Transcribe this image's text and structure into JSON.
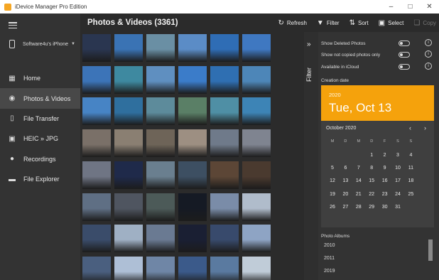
{
  "window": {
    "title": "iDevice Manager Pro Edition",
    "controls": [
      "minimize",
      "maximize",
      "close"
    ]
  },
  "sidebar": {
    "device": "Software4u's iPhone",
    "items": [
      {
        "label": "Home",
        "icon": "home-icon",
        "active": false
      },
      {
        "label": "Photos & Videos",
        "icon": "camera-icon",
        "active": true
      },
      {
        "label": "File Transfer",
        "icon": "phone-icon",
        "active": false
      },
      {
        "label": "HEIC » JPG",
        "icon": "image-icon",
        "active": false
      },
      {
        "label": "Recordings",
        "icon": "microphone-icon",
        "active": false
      },
      {
        "label": "File Explorer",
        "icon": "folder-icon",
        "active": false
      }
    ]
  },
  "header": {
    "title": "Photos & Videos (3361)",
    "refresh": "Refresh",
    "filter": "Filter",
    "sort": "Sort",
    "select": "Select",
    "copy": "Copy"
  },
  "filter": {
    "tab_label": "Filter",
    "options": [
      {
        "label": "Show Deleted Photos",
        "on": false
      },
      {
        "label": "Show not copied photos only",
        "on": false
      },
      {
        "label": "Available in iCloud",
        "on": false
      }
    ],
    "creation_date_label": "Creation date",
    "calendar": {
      "year": "2020",
      "selected": "Tue, Oct 13",
      "month": "October 2020",
      "weekdays": [
        "M",
        "D",
        "M",
        "D",
        "F",
        "S",
        "S"
      ],
      "weeks": [
        [
          "",
          "",
          "",
          "1",
          "2",
          "3",
          "4"
        ],
        [
          "5",
          "6",
          "7",
          "8",
          "9",
          "10",
          "11"
        ],
        [
          "12",
          "13",
          "14",
          "15",
          "16",
          "17",
          "18"
        ],
        [
          "19",
          "20",
          "21",
          "22",
          "23",
          "24",
          "25"
        ],
        [
          "26",
          "27",
          "28",
          "29",
          "30",
          "31",
          ""
        ]
      ]
    },
    "albums_label": "Photo Albums",
    "albums": [
      "2010",
      "2011",
      "2019"
    ]
  },
  "colors": {
    "accent": "#f5a20c",
    "background": "#2b2b2b",
    "sidebar": "#333333"
  },
  "thumbnails": [
    [
      "#2a3650",
      "#3a73b4",
      "#6a8fa4",
      "#5b8cc6",
      "#2f6db5",
      "#3f78c1"
    ],
    [
      "#3c74b8",
      "#3e89a0",
      "#5f8fc0",
      "#3b7cc9",
      "#2f6fb2",
      "#4d86b8"
    ],
    [
      "#4784c5",
      "#2f6f9e",
      "#5d8b9b",
      "#5a7f66",
      "#4f8fa5",
      "#3d84b6"
    ],
    [
      "#7a7068",
      "#8a7f72",
      "#6e6458",
      "#9d8f82",
      "#6f7a8a",
      "#7f8490"
    ],
    [
      "#6f7584",
      "#1f2a4a",
      "#6a7f8f",
      "#3d4f62",
      "#5c4636",
      "#4a3a2f"
    ],
    [
      "#5f6f84",
      "#4f5560",
      "#4c5a58",
      "#151a24",
      "#7a8ca8",
      "#b0bccb"
    ],
    [
      "#3a4c6a",
      "#9fb0c4",
      "#6a7a92",
      "#1a1f33",
      "#384a6c",
      "#8ea4c4"
    ],
    [
      "#4a5f7f",
      "#aebfd6",
      "#6f86a6",
      "#3b5a8a",
      "#5a7aa0",
      "#c0ccd8"
    ]
  ]
}
